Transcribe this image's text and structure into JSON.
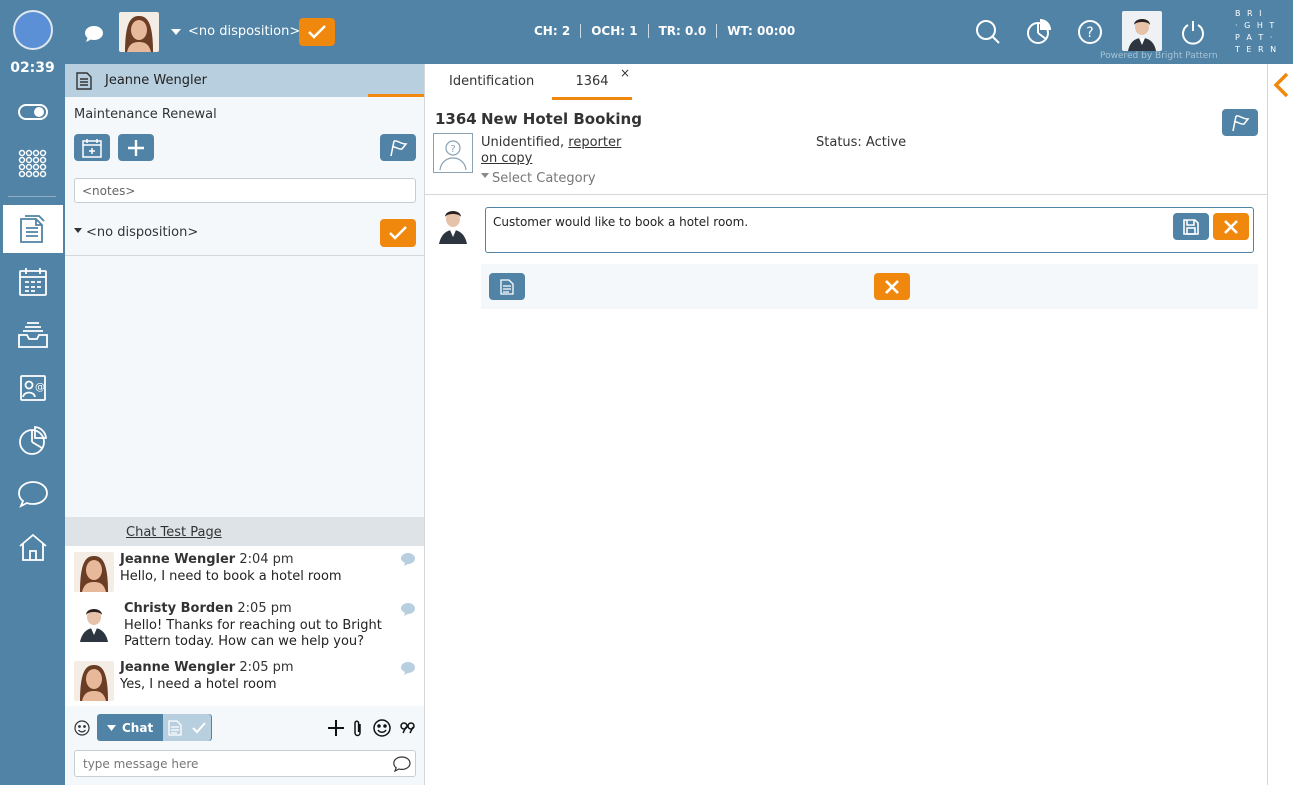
{
  "topbar": {
    "timer": "02:39",
    "disposition_label": "<no disposition>",
    "metrics": [
      "CH: 2",
      "OCH: 1",
      "TR: 0.0",
      "WT: 00:00"
    ],
    "brand_lines": [
      "B R I",
      "· G H T",
      "P A T ·",
      "T E R N"
    ],
    "powered_by": "Powered by Bright Pattern"
  },
  "leftpanel": {
    "tab_title": "Jeanne Wengler",
    "activity_title": "Maintenance Renewal",
    "notes_placeholder": "<notes>",
    "disposition_label": "<no disposition>",
    "chat_title": "Chat Test Page",
    "messages": [
      {
        "name": "Jeanne Wengler",
        "time": "2:04 pm",
        "text": "Hello, I need to book a hotel room"
      },
      {
        "name": "Christy Borden",
        "time": "2:05 pm",
        "text": "Hello! Thanks for reaching out to Bright Pattern today. How can we help you?"
      },
      {
        "name": "Jeanne Wengler",
        "time": "2:05 pm",
        "text": "Yes, I need a hotel room"
      }
    ],
    "chat_mode_label": "Chat",
    "message_placeholder": "type message here"
  },
  "main": {
    "tabs": [
      {
        "label": "Identification",
        "active": false
      },
      {
        "label": "1364",
        "active": true
      }
    ],
    "tab_close": "×",
    "case_number": "1364",
    "case_title": "New Hotel Booking",
    "contact_prefix": "Unidentified,",
    "contact_link": "reporter on copy",
    "status": "Status: Active",
    "select_category": "Select Category",
    "note_text": "Customer would like to book a hotel room."
  },
  "colors": {
    "topbar": "#5083a6",
    "accent_orange": "#f0880e",
    "button_blue": "#5083a6",
    "panel_bg": "#f4f8fa"
  }
}
